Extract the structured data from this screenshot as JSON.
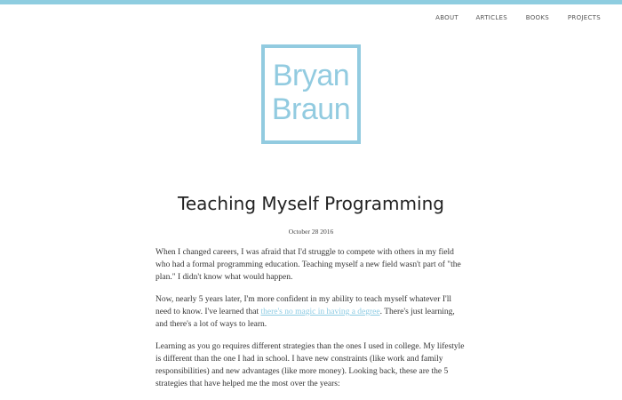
{
  "nav": {
    "about": "ABOUT",
    "articles": "ARTICLES",
    "books": "BOOKS",
    "projects": "PROJECTS"
  },
  "logo": {
    "line1": "Bryan",
    "line2": "Braun"
  },
  "post": {
    "title": "Teaching Myself Programming",
    "date": "October 28 2016",
    "p1": "When I changed careers, I was afraid that I'd struggle to compete with others in my field who had a formal programming education. Teaching myself a new field wasn't part of \"the plan.\" I didn't know what would happen.",
    "p2_before": "Now, nearly 5 years later, I'm more confident in my ability to teach myself whatever I'll need to know. I've learned that ",
    "p2_link": "there's no magic in having a degree",
    "p2_after": ". There's just learning, and there's a lot of ways to learn.",
    "p3": "Learning as you go requires different strategies than the ones I used in college. My lifestyle is different than the one I had in school. I have new constraints (like work and family responsibilities) and new advantages (like more money). Looking back, these are the 5 strategies that have helped me the most over the years:"
  },
  "colors": {
    "accent": "#8ecde0",
    "text": "#333333",
    "link": "#8ccbe3"
  }
}
